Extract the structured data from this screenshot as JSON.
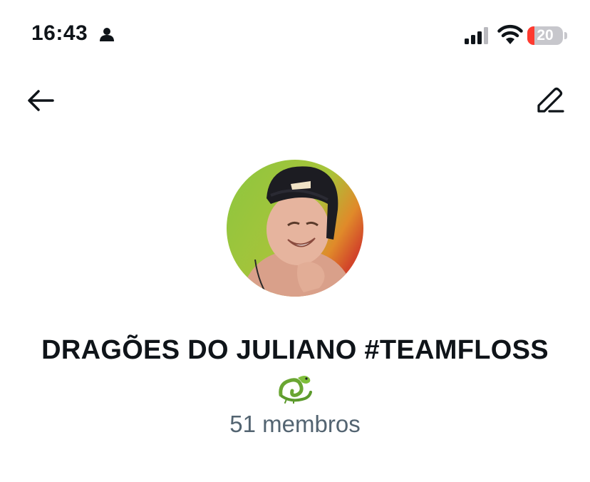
{
  "status_bar": {
    "time": "16:43",
    "battery_level": "20",
    "battery_fraction": 0.2,
    "icons": [
      "person-icon",
      "signal-icon",
      "wifi-icon",
      "battery-icon"
    ]
  },
  "header": {
    "back_icon": "arrow-left-icon",
    "edit_icon": "pencil-icon"
  },
  "group": {
    "name": "DRAGÕES DO JULIANO #TEAMFLOSS",
    "emoji": "dragon-emoji",
    "member_count": "51 membros"
  },
  "colors": {
    "text_primary": "#0f1419",
    "text_secondary": "#536471",
    "battery_low": "#ff3b30",
    "avatar_bg": "#8bbf2e"
  }
}
